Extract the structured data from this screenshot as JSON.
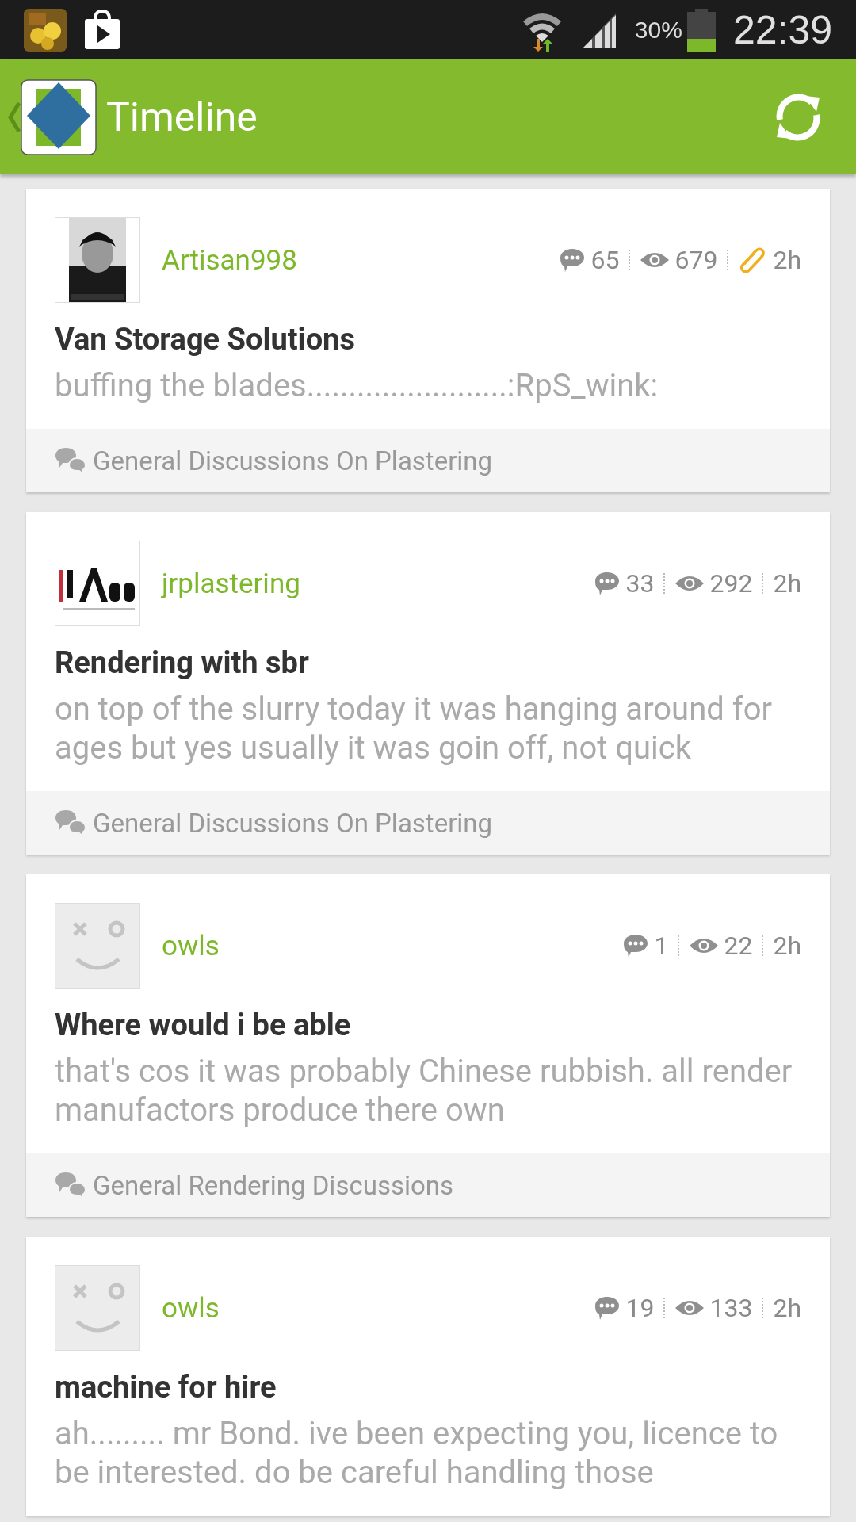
{
  "status_bar": {
    "battery": "30%",
    "time": "22:39"
  },
  "header": {
    "title": "Timeline"
  },
  "posts": [
    {
      "author": "Artisan998",
      "comments": "65",
      "views": "679",
      "attachment": true,
      "age": "2h",
      "title": "Van Storage Solutions",
      "excerpt": "buffing the blades........................:RpS_wink:",
      "forum": "General Discussions On Plastering"
    },
    {
      "author": "jrplastering",
      "kind": "logo",
      "comments": "33",
      "views": "292",
      "attachment": false,
      "age": "2h",
      "title": "Rendering with sbr",
      "excerpt": "on top of the slurry today it was hanging around for ages but yes usually it was goin off, not quick",
      "forum": "General Discussions On Plastering"
    },
    {
      "author": "owls",
      "kind": "default",
      "comments": "1",
      "views": "22",
      "attachment": false,
      "age": "2h",
      "title": "Where would i be able",
      "excerpt": "that's cos it was probably Chinese rubbish. all render manufactors produce there own",
      "forum": "General Rendering Discussions"
    },
    {
      "author": "owls",
      "kind": "default",
      "comments": "19",
      "views": "133",
      "attachment": false,
      "age": "2h",
      "title": "machine for hire",
      "excerpt": "ah......... mr Bond. ive been expecting you, licence to be interested. do be careful handling those"
    }
  ]
}
